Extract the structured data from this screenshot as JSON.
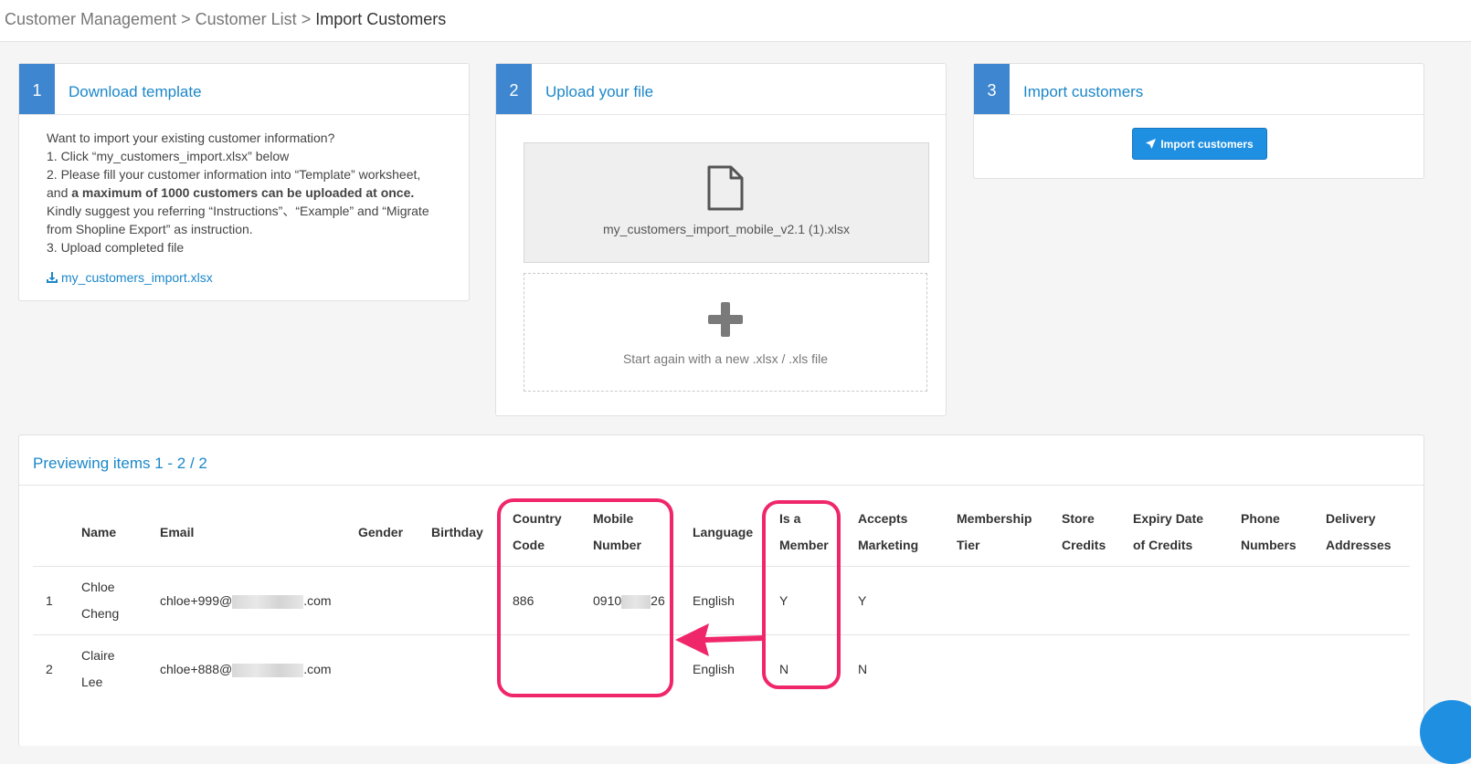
{
  "breadcrumb": {
    "items": [
      "Customer Management",
      "Customer List"
    ],
    "separator": ">",
    "current": "Import Customers"
  },
  "step1": {
    "number": "1",
    "title": "Download template",
    "lines": [
      "Want to import your existing customer information?",
      "1. Click “my_customers_import.xlsx” below",
      "2. Please fill your customer information into “Template” worksheet,",
      "Kindly suggest you referring “Instructions”、“Example” and “Migrate",
      "from Shopline Export” as instruction.",
      "3. Upload completed file"
    ],
    "and_prefix": "and ",
    "bold_text": "a maximum of 1000 customers can be uploaded at once.",
    "download_link": "my_customers_import.xlsx",
    "download_icon": "download-icon"
  },
  "step2": {
    "number": "2",
    "title": "Upload your file",
    "file_name": "my_customers_import_mobile_v2.1 (1).xlsx",
    "file_icon": "file-icon",
    "drop_text": "Start again with a new .xlsx / .xls file",
    "drop_icon": "plus-icon"
  },
  "step3": {
    "number": "3",
    "title": "Import customers",
    "button_label": "Import customers",
    "button_icon": "rocket-icon"
  },
  "preview": {
    "title": "Previewing items 1 - 2 / 2",
    "columns": [
      {
        "line1": "Name",
        "line2": ""
      },
      {
        "line1": "Email",
        "line2": ""
      },
      {
        "line1": "Gender",
        "line2": ""
      },
      {
        "line1": "Birthday",
        "line2": ""
      },
      {
        "line1": "Country",
        "line2": "Code"
      },
      {
        "line1": "Mobile",
        "line2": "Number"
      },
      {
        "line1": "Language",
        "line2": ""
      },
      {
        "line1": "Is a",
        "line2": "Member"
      },
      {
        "line1": "Accepts",
        "line2": "Marketing"
      },
      {
        "line1": "Membership",
        "line2": "Tier"
      },
      {
        "line1": "Store",
        "line2": "Credits"
      },
      {
        "line1": "Expiry Date",
        "line2": "of Credits"
      },
      {
        "line1": "Phone",
        "line2": "Numbers"
      },
      {
        "line1": "Delivery",
        "line2": "Addresses"
      }
    ],
    "rows": [
      {
        "index": "1",
        "name_line1": "Chloe",
        "name_line2": "Cheng",
        "email_prefix": "chloe+999@",
        "email_suffix": ".com",
        "country_code": "886",
        "mobile_prefix": "0910",
        "mobile_suffix": "26",
        "language": "English",
        "is_member": "Y",
        "accepts_marketing": "Y"
      },
      {
        "index": "2",
        "name_line1": "Claire",
        "name_line2": "Lee",
        "email_prefix": "chloe+888@",
        "email_suffix": ".com",
        "country_code": "",
        "mobile_prefix": "",
        "mobile_suffix": "",
        "language": "English",
        "is_member": "N",
        "accepts_marketing": "N"
      }
    ]
  },
  "annotations": {
    "highlight_color": "#f0266b"
  },
  "colors": {
    "accent": "#1b87c9",
    "step_badge": "#3e86cf",
    "button": "#1f8fe1"
  }
}
